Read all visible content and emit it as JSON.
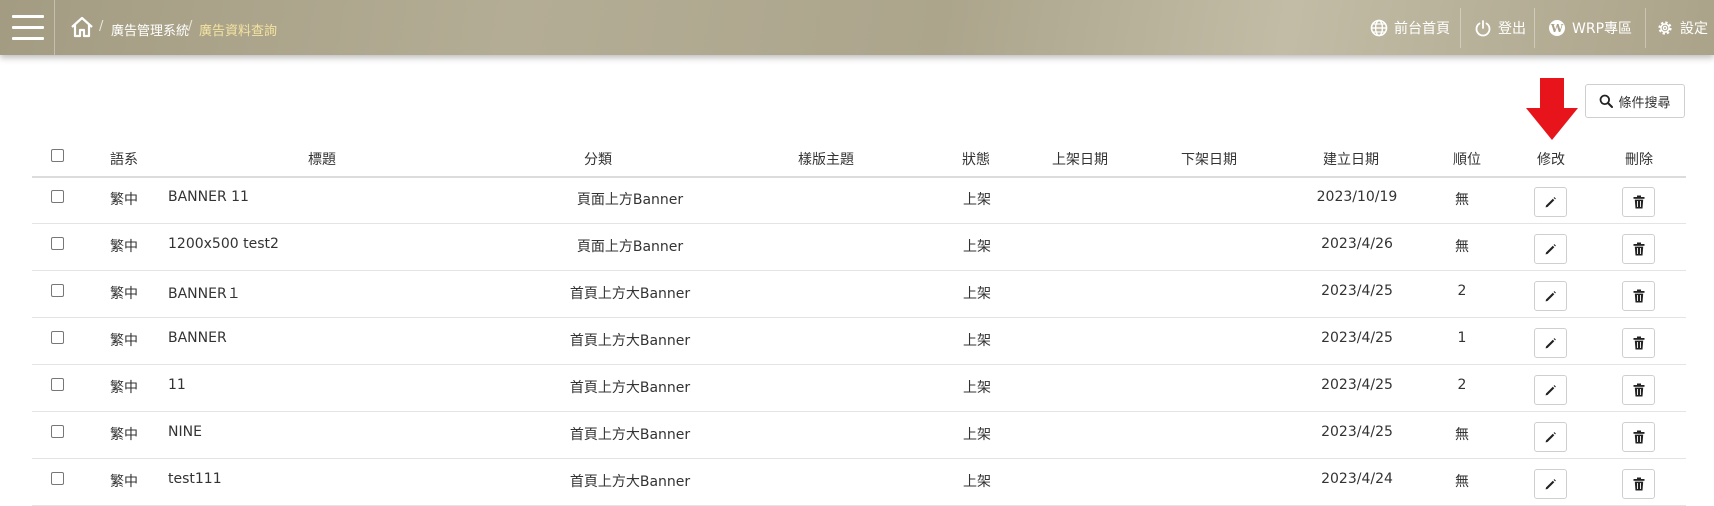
{
  "breadcrumb": {
    "root": "廣告管理系統",
    "current": "廣告資料查詢",
    "separator": "/"
  },
  "nav": {
    "frontpage": "前台首頁",
    "logout": "登出",
    "wrp": "WRP專區",
    "settings": "設定"
  },
  "toolbar": {
    "search_label": "條件搜尋"
  },
  "table": {
    "headers": {
      "language": "語系",
      "title": "標題",
      "category": "分類",
      "template": "樣版主題",
      "status": "狀態",
      "publish_date": "上架日期",
      "unpublish_date": "下架日期",
      "created": "建立日期",
      "order": "順位",
      "edit": "修改",
      "delete": "刪除"
    },
    "rows": [
      {
        "language": "繁中",
        "title": "BANNER  11",
        "category": "頁面上方Banner",
        "template": "",
        "status": "上架",
        "publish_date": "",
        "unpublish_date": "",
        "created": "2023/10/19",
        "order": "無"
      },
      {
        "language": "繁中",
        "title": "1200x500 test2",
        "category": "頁面上方Banner",
        "template": "",
        "status": "上架",
        "publish_date": "",
        "unpublish_date": "",
        "created": "2023/4/26",
        "order": "無"
      },
      {
        "language": "繁中",
        "title": "BANNER１",
        "category": "首頁上方大Banner",
        "template": "",
        "status": "上架",
        "publish_date": "",
        "unpublish_date": "",
        "created": "2023/4/25",
        "order": "2"
      },
      {
        "language": "繁中",
        "title": "BANNER",
        "category": "首頁上方大Banner",
        "template": "",
        "status": "上架",
        "publish_date": "",
        "unpublish_date": "",
        "created": "2023/4/25",
        "order": "1"
      },
      {
        "language": "繁中",
        "title": "11",
        "category": "首頁上方大Banner",
        "template": "",
        "status": "上架",
        "publish_date": "",
        "unpublish_date": "",
        "created": "2023/4/25",
        "order": "2"
      },
      {
        "language": "繁中",
        "title": "NINE",
        "category": "首頁上方大Banner",
        "template": "",
        "status": "上架",
        "publish_date": "",
        "unpublish_date": "",
        "created": "2023/4/25",
        "order": "無"
      },
      {
        "language": "繁中",
        "title": "test111",
        "category": "首頁上方大Banner",
        "template": "",
        "status": "上架",
        "publish_date": "",
        "unpublish_date": "",
        "created": "2023/4/24",
        "order": "無"
      }
    ]
  },
  "colors": {
    "arrow": "#e8141b",
    "accent_crumb": "#f3e3a0"
  }
}
